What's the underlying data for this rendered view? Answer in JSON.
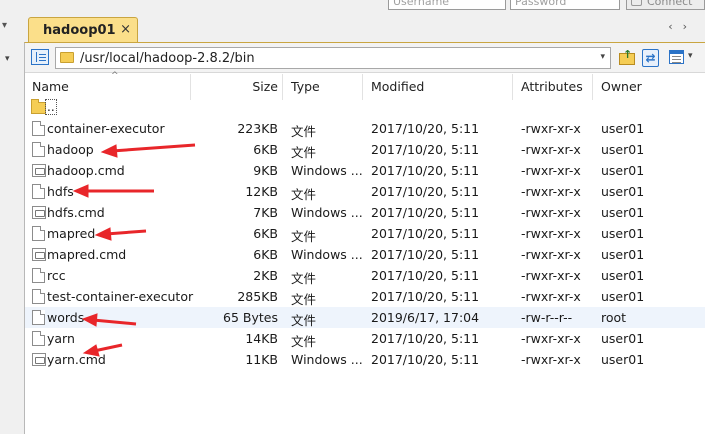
{
  "login": {
    "username_placeholder": "Username",
    "password_placeholder": "Password",
    "connect_label": "Connect"
  },
  "tabs": [
    {
      "label": "hadoop01",
      "close": "×"
    }
  ],
  "tab_nav": {
    "prev": "‹",
    "next": "›"
  },
  "toolbar": {
    "path": "/usr/local/hadoop-2.8.2/bin",
    "dropdown": "▾",
    "up_arrow": "↑",
    "refresh": "⇄"
  },
  "columns": {
    "name": "Name",
    "size": "Size",
    "type": "Type",
    "modified": "Modified",
    "attributes": "Attributes",
    "owner": "Owner",
    "sort_indicator": "^"
  },
  "parent_dir": {
    "label": ".."
  },
  "files": [
    {
      "name": "container-executor",
      "size": "223KB",
      "type": "文件",
      "modified": "2017/10/20, 5:11",
      "attributes": "-rwxr-xr-x",
      "owner": "user01",
      "icon": "doc"
    },
    {
      "name": "hadoop",
      "size": "6KB",
      "type": "文件",
      "modified": "2017/10/20, 5:11",
      "attributes": "-rwxr-xr-x",
      "owner": "user01",
      "icon": "doc"
    },
    {
      "name": "hadoop.cmd",
      "size": "9KB",
      "type": "Windows ...",
      "modified": "2017/10/20, 5:11",
      "attributes": "-rwxr-xr-x",
      "owner": "user01",
      "icon": "cmd"
    },
    {
      "name": "hdfs",
      "size": "12KB",
      "type": "文件",
      "modified": "2017/10/20, 5:11",
      "attributes": "-rwxr-xr-x",
      "owner": "user01",
      "icon": "doc"
    },
    {
      "name": "hdfs.cmd",
      "size": "7KB",
      "type": "Windows ...",
      "modified": "2017/10/20, 5:11",
      "attributes": "-rwxr-xr-x",
      "owner": "user01",
      "icon": "cmd"
    },
    {
      "name": "mapred",
      "size": "6KB",
      "type": "文件",
      "modified": "2017/10/20, 5:11",
      "attributes": "-rwxr-xr-x",
      "owner": "user01",
      "icon": "doc"
    },
    {
      "name": "mapred.cmd",
      "size": "6KB",
      "type": "Windows ...",
      "modified": "2017/10/20, 5:11",
      "attributes": "-rwxr-xr-x",
      "owner": "user01",
      "icon": "cmd"
    },
    {
      "name": "rcc",
      "size": "2KB",
      "type": "文件",
      "modified": "2017/10/20, 5:11",
      "attributes": "-rwxr-xr-x",
      "owner": "user01",
      "icon": "doc"
    },
    {
      "name": "test-container-executor",
      "size": "285KB",
      "type": "文件",
      "modified": "2017/10/20, 5:11",
      "attributes": "-rwxr-xr-x",
      "owner": "user01",
      "icon": "doc"
    },
    {
      "name": "words",
      "size": "65 Bytes",
      "type": "文件",
      "modified": "2019/6/17, 17:04",
      "attributes": "-rw-r--r--",
      "owner": "root",
      "icon": "doc"
    },
    {
      "name": "yarn",
      "size": "14KB",
      "type": "文件",
      "modified": "2017/10/20, 5:11",
      "attributes": "-rwxr-xr-x",
      "owner": "user01",
      "icon": "doc"
    },
    {
      "name": "yarn.cmd",
      "size": "11KB",
      "type": "Windows ...",
      "modified": "2017/10/20, 5:11",
      "attributes": "-rwxr-xr-x",
      "owner": "user01",
      "icon": "cmd"
    }
  ],
  "colors": {
    "tab_bg": "#fbdf8a",
    "annotation_arrow": "#e8262a",
    "selected_row": "#eef4fc",
    "folder": "#f5cd55"
  }
}
